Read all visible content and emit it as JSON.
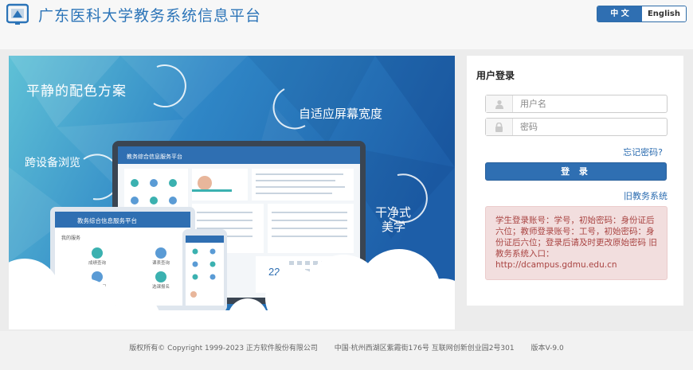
{
  "header": {
    "title": "广东医科大学教务系统信息平台",
    "lang_zh": "中 文",
    "lang_en": "English"
  },
  "banner": {
    "slogan_1": "平静的配色方案",
    "slogan_2": "自适应屏幕宽度",
    "slogan_3": "跨设备浏览",
    "slogan_4a": "干净式",
    "slogan_4b": "美学",
    "monitor_title": "教务综合信息服务平台",
    "tablet_title": "教务综合信息服务平台",
    "tablet_section": "我的服务",
    "tablet_items": [
      "成绩查询",
      "课表查询",
      "学业情况",
      "选课报名"
    ],
    "calendar_day": "22"
  },
  "login": {
    "title": "用户登录",
    "username_placeholder": "用户名",
    "password_placeholder": "密码",
    "forgot": "忘记密码?",
    "submit": "登 录",
    "old_system": "旧教务系统",
    "notice": "学生登录账号：学号，初始密码：身份证后六位；教师登录账号：工号，初始密码：身份证后六位；登录后请及时更改原始密码 旧教务系统入口：http://dcampus.gdmu.edu.cn"
  },
  "footer": {
    "copyright": "版权所有© Copyright 1999-2023 正方软件股份有限公司",
    "address": "中国·杭州西湖区紫霞街176号 互联网创新创业园2号301",
    "version": "版本V-9.0"
  },
  "colors": {
    "brand_blue": "#2f6fb2",
    "title_blue": "#2b74b8",
    "notice_bg": "#f2dede",
    "notice_text": "#a94442"
  }
}
